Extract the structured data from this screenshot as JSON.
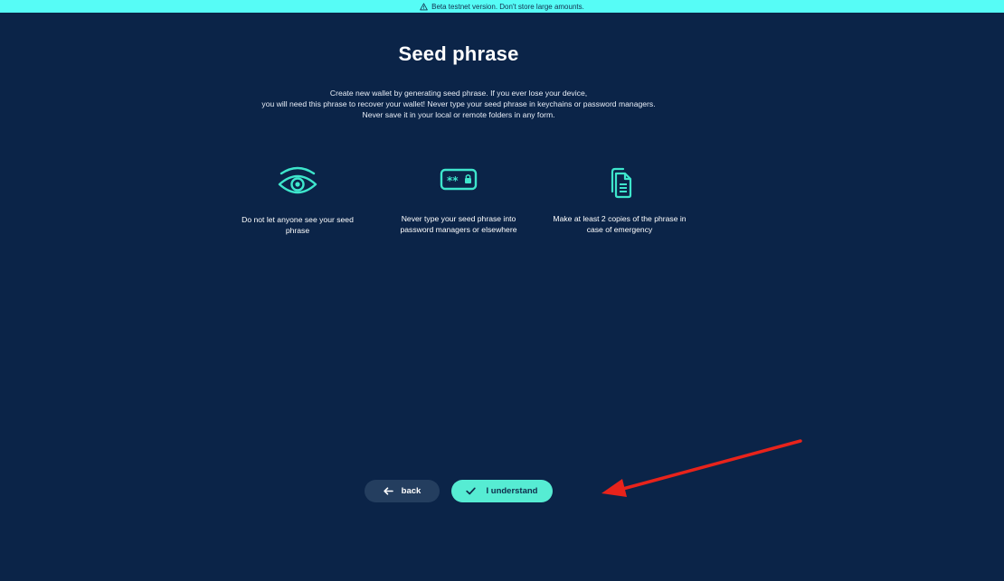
{
  "banner": {
    "text": "Beta testnet version. Don't store large amounts."
  },
  "page": {
    "title": "Seed phrase",
    "description_lines": [
      "Create new wallet by generating seed phrase. If you ever lose your device,",
      "you will need this phrase to recover your wallet! Never type your seed phrase in keychains or password managers.",
      "Never save it in your local or remote folders in any form."
    ]
  },
  "tips": [
    {
      "icon": "eye-icon",
      "text": "Do not let anyone see your seed phrase"
    },
    {
      "icon": "password-field-icon",
      "text": "Never type your seed phrase into password managers or elsewhere"
    },
    {
      "icon": "document-copies-icon",
      "text": "Make at least 2 copies of the phrase in case of emergency"
    }
  ],
  "buttons": {
    "back_label": "back",
    "understand_label": "I understand"
  },
  "colors": {
    "background": "#0b2448",
    "banner": "#56fcf6",
    "accent": "#56ecd3",
    "icon": "#3ee6cc",
    "back_button": "#243e5f",
    "annotation_arrow": "#e8231b"
  }
}
